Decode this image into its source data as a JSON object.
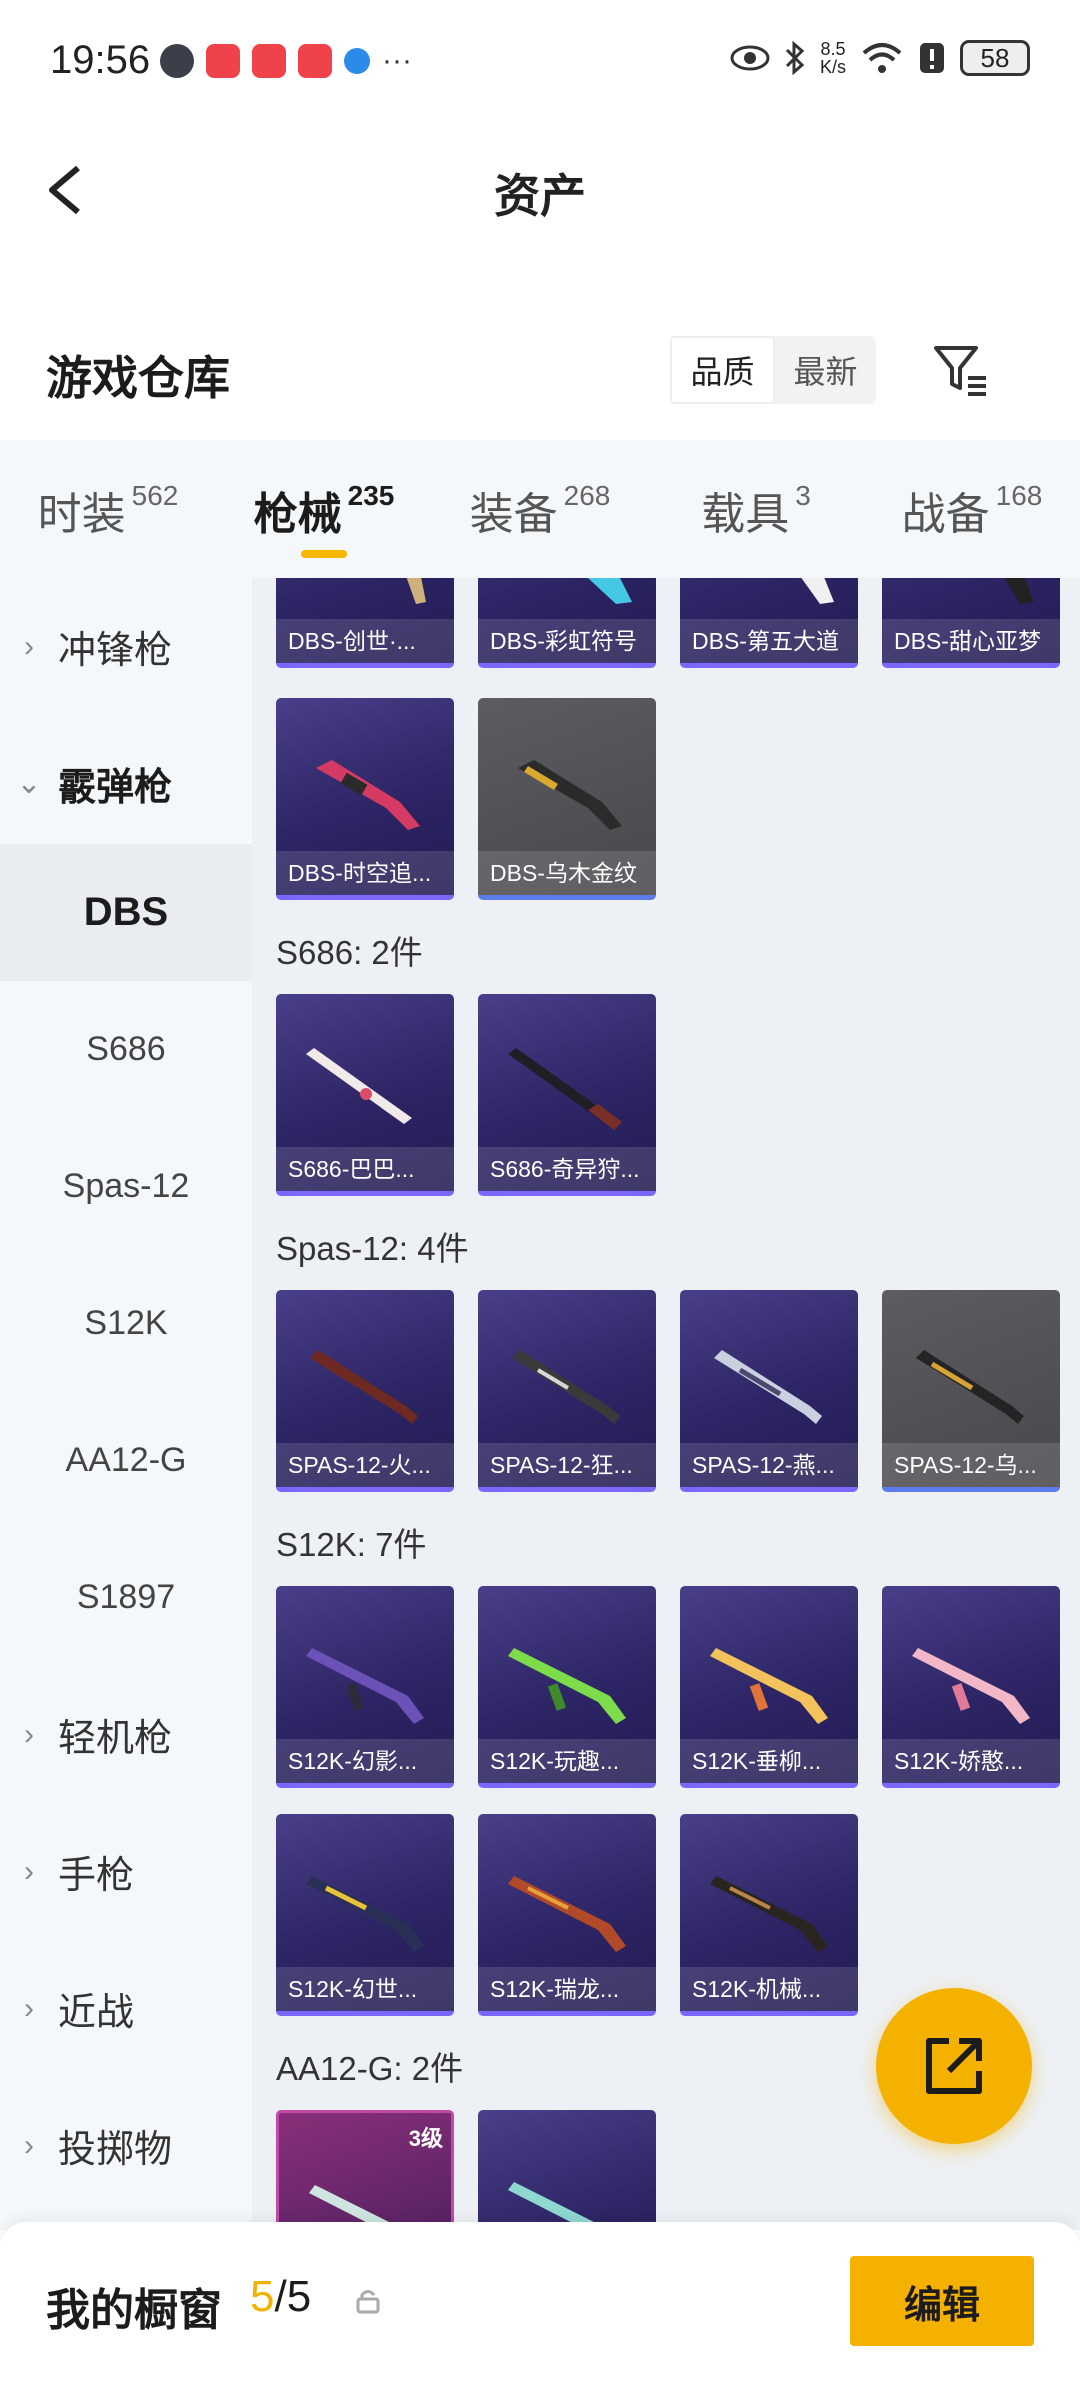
{
  "status_bar": {
    "time": "19:56",
    "net_speed_value": "8.5",
    "net_speed_unit": "K/s",
    "battery": "58"
  },
  "header": {
    "title": "资产"
  },
  "section": {
    "title": "游戏仓库",
    "sort_options": [
      "品质",
      "最新"
    ]
  },
  "tabs": [
    {
      "label": "时装",
      "count": "562"
    },
    {
      "label": "枪械",
      "count": "235"
    },
    {
      "label": "装备",
      "count": "268"
    },
    {
      "label": "载具",
      "count": "3"
    },
    {
      "label": "战备",
      "count": "168"
    }
  ],
  "sidebar": {
    "categories": [
      "冲锋枪",
      "霰弹枪",
      "轻机枪",
      "手枪",
      "近战",
      "投掷物"
    ],
    "sub_items": [
      "DBS",
      "S686",
      "Spas-12",
      "S12K",
      "AA12-G",
      "S1897"
    ]
  },
  "groups": {
    "dbs_row1": [
      "DBS-创世·...",
      "DBS-彩虹符号",
      "DBS-第五大道",
      "DBS-甜心亚梦"
    ],
    "dbs_row2": [
      "DBS-时空追...",
      "DBS-乌木金纹"
    ],
    "s686_label": "S686: 2件",
    "s686": [
      "S686-巴巴...",
      "S686-奇异狩..."
    ],
    "spas_label": "Spas-12: 4件",
    "spas": [
      "SPAS-12-火...",
      "SPAS-12-狂...",
      "SPAS-12-燕...",
      "SPAS-12-乌..."
    ],
    "s12k_label": "S12K: 7件",
    "s12k_row1": [
      "S12K-幻影...",
      "S12K-玩趣...",
      "S12K-垂柳...",
      "S12K-娇憨..."
    ],
    "s12k_row2": [
      "S12K-幻世...",
      "S12K-瑞龙...",
      "S12K-机械..."
    ],
    "aa12_label": "AA12-G: 2件",
    "aa12_level": "3级"
  },
  "bottom": {
    "label": "我的橱窗",
    "current": "5",
    "sep_total": "/5",
    "edit": "编辑"
  },
  "colors": {
    "accent": "#f5b100",
    "card_purple": "#2d2565",
    "card_gray": "#4f4f55"
  }
}
